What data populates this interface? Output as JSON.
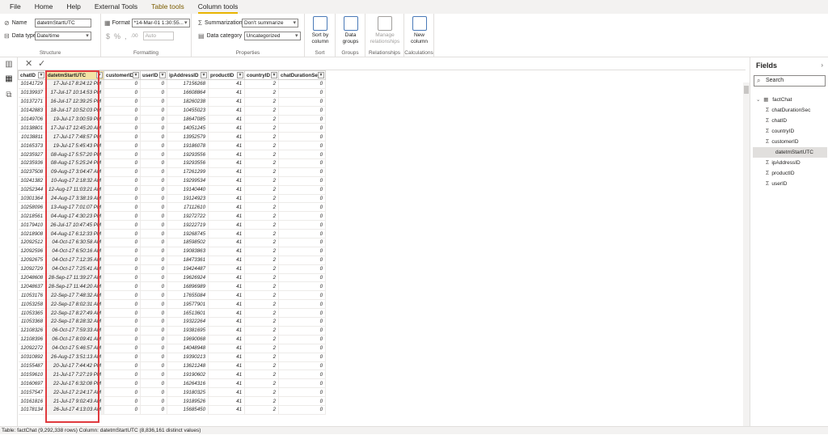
{
  "menu": {
    "tabs": [
      "File",
      "Home",
      "Help",
      "External Tools",
      "Table tools",
      "Column tools"
    ]
  },
  "ribbon": {
    "structure": {
      "name_label": "Name",
      "name_value": "datetmStartUTC",
      "datatype_label": "Data type",
      "datatype_value": "Date/time",
      "group_label": "Structure"
    },
    "formatting": {
      "format_label": "Format",
      "format_value": "*14-Mar-01 1:30:55...",
      "currency": "$",
      "percent": "%",
      "comma": ",",
      "decimals": ".00",
      "auto_value": "Auto",
      "group_label": "Formatting"
    },
    "properties": {
      "summarization_label": "Summarization",
      "summarization_value": "Don't summarize",
      "category_label": "Data category",
      "category_value": "Uncategorized",
      "group_label": "Properties"
    },
    "sort": {
      "button_label": "Sort by column",
      "group_label": "Sort"
    },
    "groups": {
      "button_label": "Data groups",
      "group_label": "Groups"
    },
    "relationships": {
      "button_label": "Manage relationships",
      "group_label": "Relationships"
    },
    "calculations": {
      "button_label": "New column",
      "group_label": "Calculations"
    }
  },
  "grid": {
    "columns": [
      "chatID",
      "datetmStartUTC",
      "customerID",
      "userID",
      "ipAddressID",
      "productID",
      "countryID",
      "chatDurationSec"
    ],
    "rows": [
      [
        "10141729",
        "17-Jul-17 8:24:12 PM",
        "0",
        "0",
        "17156268",
        "41",
        "2",
        "0"
      ],
      [
        "10139937",
        "17-Jul-17 10:14:53 PM",
        "0",
        "0",
        "16608864",
        "41",
        "2",
        "0"
      ],
      [
        "10137271",
        "16-Jul-17 12:39:25 PM",
        "0",
        "0",
        "18260238",
        "41",
        "2",
        "0"
      ],
      [
        "10142883",
        "18-Jul-17 10:52:03 PM",
        "0",
        "0",
        "10455023",
        "41",
        "2",
        "0"
      ],
      [
        "10149706",
        "19-Jul-17 3:00:59 PM",
        "0",
        "0",
        "18647085",
        "41",
        "2",
        "0"
      ],
      [
        "10138801",
        "17-Jul-17 12:45:20 AM",
        "0",
        "0",
        "14051245",
        "41",
        "2",
        "0"
      ],
      [
        "10138811",
        "17-Jul-17 7:48:57 PM",
        "0",
        "0",
        "13952579",
        "41",
        "2",
        "0"
      ],
      [
        "10165373",
        "19-Jul-17 5:45:43 PM",
        "0",
        "0",
        "19186078",
        "41",
        "2",
        "0"
      ],
      [
        "10235927",
        "08-Aug-17 5:57:20 PM",
        "0",
        "0",
        "19293556",
        "41",
        "2",
        "0"
      ],
      [
        "10235936",
        "08-Aug-17 5:25:24 PM",
        "0",
        "0",
        "19293556",
        "41",
        "2",
        "0"
      ],
      [
        "10237508",
        "09-Aug-17 3:04:47 AM",
        "0",
        "0",
        "17261299",
        "41",
        "2",
        "0"
      ],
      [
        "10241382",
        "10-Aug-17 2:18:32 AM",
        "0",
        "0",
        "19299534",
        "41",
        "2",
        "0"
      ],
      [
        "10252344",
        "12-Aug-17 11:03:21 AM",
        "0",
        "0",
        "19140440",
        "41",
        "2",
        "0"
      ],
      [
        "10301364",
        "24-Aug-17 3:38:19 AM",
        "0",
        "0",
        "19124923",
        "41",
        "2",
        "0"
      ],
      [
        "10258096",
        "13-Aug-17 7:01:07 PM",
        "0",
        "0",
        "17112610",
        "41",
        "2",
        "0"
      ],
      [
        "10218561",
        "04-Aug-17 4:30:23 PM",
        "0",
        "0",
        "19272722",
        "41",
        "2",
        "0"
      ],
      [
        "10179410",
        "26-Jul-17 10:47:45 PM",
        "0",
        "0",
        "19222719",
        "41",
        "2",
        "0"
      ],
      [
        "10218908",
        "04-Aug-17 6:12:33 PM",
        "0",
        "0",
        "19268745",
        "41",
        "2",
        "0"
      ],
      [
        "12092512",
        "04-Oct-17 6:30:58 AM",
        "0",
        "0",
        "18598502",
        "41",
        "2",
        "0"
      ],
      [
        "12092596",
        "04-Oct-17 6:50:16 AM",
        "0",
        "0",
        "19083863",
        "41",
        "2",
        "0"
      ],
      [
        "12092675",
        "04-Oct-17 7:12:35 AM",
        "0",
        "0",
        "18473361",
        "41",
        "2",
        "0"
      ],
      [
        "12092729",
        "04-Oct-17 7:25:41 AM",
        "0",
        "0",
        "19424487",
        "41",
        "2",
        "0"
      ],
      [
        "12048608",
        "28-Sep-17 11:39:27 AM",
        "0",
        "0",
        "19626924",
        "41",
        "2",
        "0"
      ],
      [
        "12048637",
        "28-Sep-17 11:44:20 AM",
        "0",
        "0",
        "16896989",
        "41",
        "2",
        "0"
      ],
      [
        "11053176",
        "22-Sep-17 7:48:32 AM",
        "0",
        "0",
        "17655084",
        "41",
        "2",
        "0"
      ],
      [
        "11053258",
        "22-Sep-17 8:02:31 AM",
        "0",
        "0",
        "19577901",
        "41",
        "2",
        "0"
      ],
      [
        "11053365",
        "22-Sep-17 8:27:49 AM",
        "0",
        "0",
        "16513601",
        "41",
        "2",
        "0"
      ],
      [
        "11053368",
        "22-Sep-17 8:28:32 AM",
        "0",
        "0",
        "19322264",
        "41",
        "2",
        "0"
      ],
      [
        "12108326",
        "06-Oct-17 7:59:33 AM",
        "0",
        "0",
        "19381695",
        "41",
        "2",
        "0"
      ],
      [
        "12108396",
        "06-Oct-17 8:09:41 AM",
        "0",
        "0",
        "19690068",
        "41",
        "2",
        "0"
      ],
      [
        "12092272",
        "04-Oct-17 5:46:57 AM",
        "0",
        "0",
        "14048948",
        "41",
        "2",
        "0"
      ],
      [
        "10310892",
        "26-Aug-17 3:51:13 AM",
        "0",
        "0",
        "19390213",
        "41",
        "2",
        "0"
      ],
      [
        "10155487",
        "20-Jul-17 7:44:42 PM",
        "0",
        "0",
        "13621248",
        "41",
        "2",
        "0"
      ],
      [
        "10159610",
        "21-Jul-17 7:27:19 PM",
        "0",
        "0",
        "19190602",
        "41",
        "2",
        "0"
      ],
      [
        "10160697",
        "22-Jul-17 6:32:08 PM",
        "0",
        "0",
        "16264316",
        "41",
        "2",
        "0"
      ],
      [
        "10157547",
        "22-Jul-17 2:24:17 AM",
        "0",
        "0",
        "19180325",
        "41",
        "2",
        "0"
      ],
      [
        "10161816",
        "21-Jul-17 9:02:43 AM",
        "0",
        "0",
        "19189526",
        "41",
        "2",
        "0"
      ],
      [
        "10178134",
        "26-Jul-17 4:13:03 AM",
        "0",
        "0",
        "15685450",
        "41",
        "2",
        "0"
      ]
    ]
  },
  "fields_pane": {
    "title": "Fields",
    "search_placeholder": "Search",
    "table_name": "factChat",
    "fields": [
      "chatDurationSec",
      "chatID",
      "countryID",
      "customerID",
      "datetmStartUTC",
      "ipAddressID",
      "productID",
      "userID"
    ],
    "selected_field": "datetmStartUTC"
  },
  "status_bar": {
    "text": "Table: factChat (9,292,338 rows) Column: datetmStartUTC (8,836,161 distinct values)"
  },
  "colors": {
    "accent": "#e8b400",
    "selection_header": "#f3e3a6",
    "highlight_box": "#e03a3e"
  }
}
